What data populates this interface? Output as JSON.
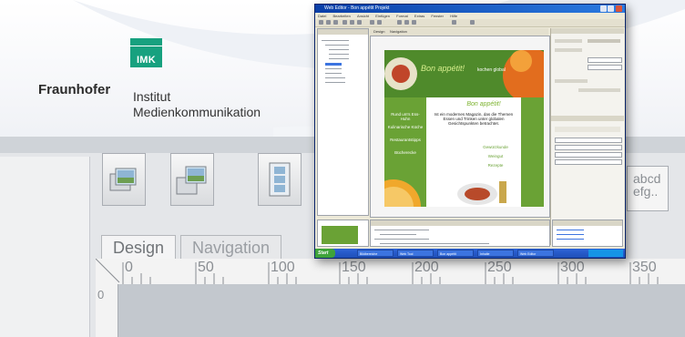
{
  "logo": {
    "badge_text": "IMK",
    "org_name": "Fraunhofer",
    "institute_line1": "Institut",
    "institute_line2": "Medienkommunikation",
    "badge_color": "#17a17f"
  },
  "big_app": {
    "tabs": [
      {
        "label": "Design",
        "active": true
      },
      {
        "label": "Navigation",
        "active": false
      }
    ],
    "ruler_labels": [
      "0",
      "50",
      "100",
      "150",
      "200",
      "250",
      "300",
      "350"
    ],
    "vertical_ruler_label": "0",
    "text_tool_label": "abcd efg..",
    "toolbar_icons": [
      "page-stack-icon",
      "page-copy-icon",
      "filmstrip-icon"
    ]
  },
  "screenshot_window": {
    "title": "Web Editor - Bon appétit Projekt",
    "menu": [
      "Datei",
      "Bearbeiten",
      "Ansicht",
      "Einfügen",
      "Format",
      "Extras",
      "Fenster",
      "Hilfe"
    ],
    "tabs": [
      "Design",
      "Navigation"
    ],
    "page": {
      "header": "Bon appétit!",
      "header_sub": "kochen global",
      "nav_items": [
        "Rund um's Ess-Huhn",
        "Kulinarische Küche",
        "Restaurantstipps",
        "Bücherecke"
      ],
      "body_title": "Bon appétit!",
      "body_text": "Ist ein modernes Magazin, das die Themen Essen und Trinken unter globalen Gesichtspunkten betrachtet.",
      "side_list": [
        "Gewürzkunde",
        "Weingut",
        "Rezepte"
      ]
    },
    "taskbar": {
      "start_label": "Start",
      "items": [
        "Bildbereiche",
        "Web Tool",
        "Bon appétit",
        "Inhalte",
        "Web Editor"
      ]
    },
    "colors": {
      "page_green": "#6aa235",
      "header_green": "#4f8a2b",
      "titlebar_blue": "#0a3fa8"
    }
  }
}
